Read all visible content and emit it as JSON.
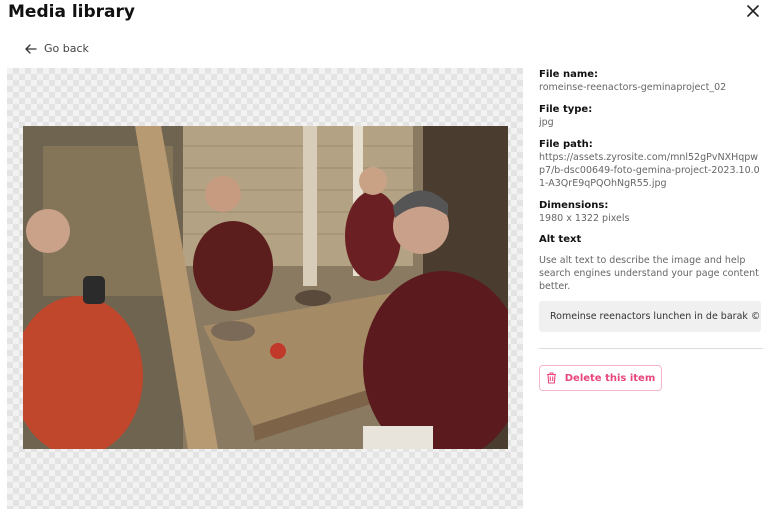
{
  "header": {
    "title": "Media library",
    "close_icon": "close-icon"
  },
  "nav": {
    "back_label": "Go back",
    "back_icon": "arrow-left-icon"
  },
  "file": {
    "name_label": "File name:",
    "name": "romeinse-reenactors-geminaproject_02",
    "type_label": "File type:",
    "type": "jpg",
    "path_label": "File path:",
    "path": "https://assets.zyrosite.com/mnl52gPvNXHqpwp7/b-dsc00649-foto-gemina-project-2023.10.01-A3QrE9qPQOhNgR55.jpg",
    "dimensions_label": "Dimensions:",
    "dimensions": "1980 x 1322 pixels"
  },
  "alt": {
    "label": "Alt text",
    "description": "Use alt text to describe the image and help search engines understand your page content better.",
    "value": "Romeinse reenactors lunchen in de barak © Gemina project"
  },
  "actions": {
    "delete_label": "Delete this item",
    "delete_icon": "trash-icon"
  },
  "colors": {
    "accent": "#e8467c",
    "accent_border": "#f3b6c9"
  }
}
